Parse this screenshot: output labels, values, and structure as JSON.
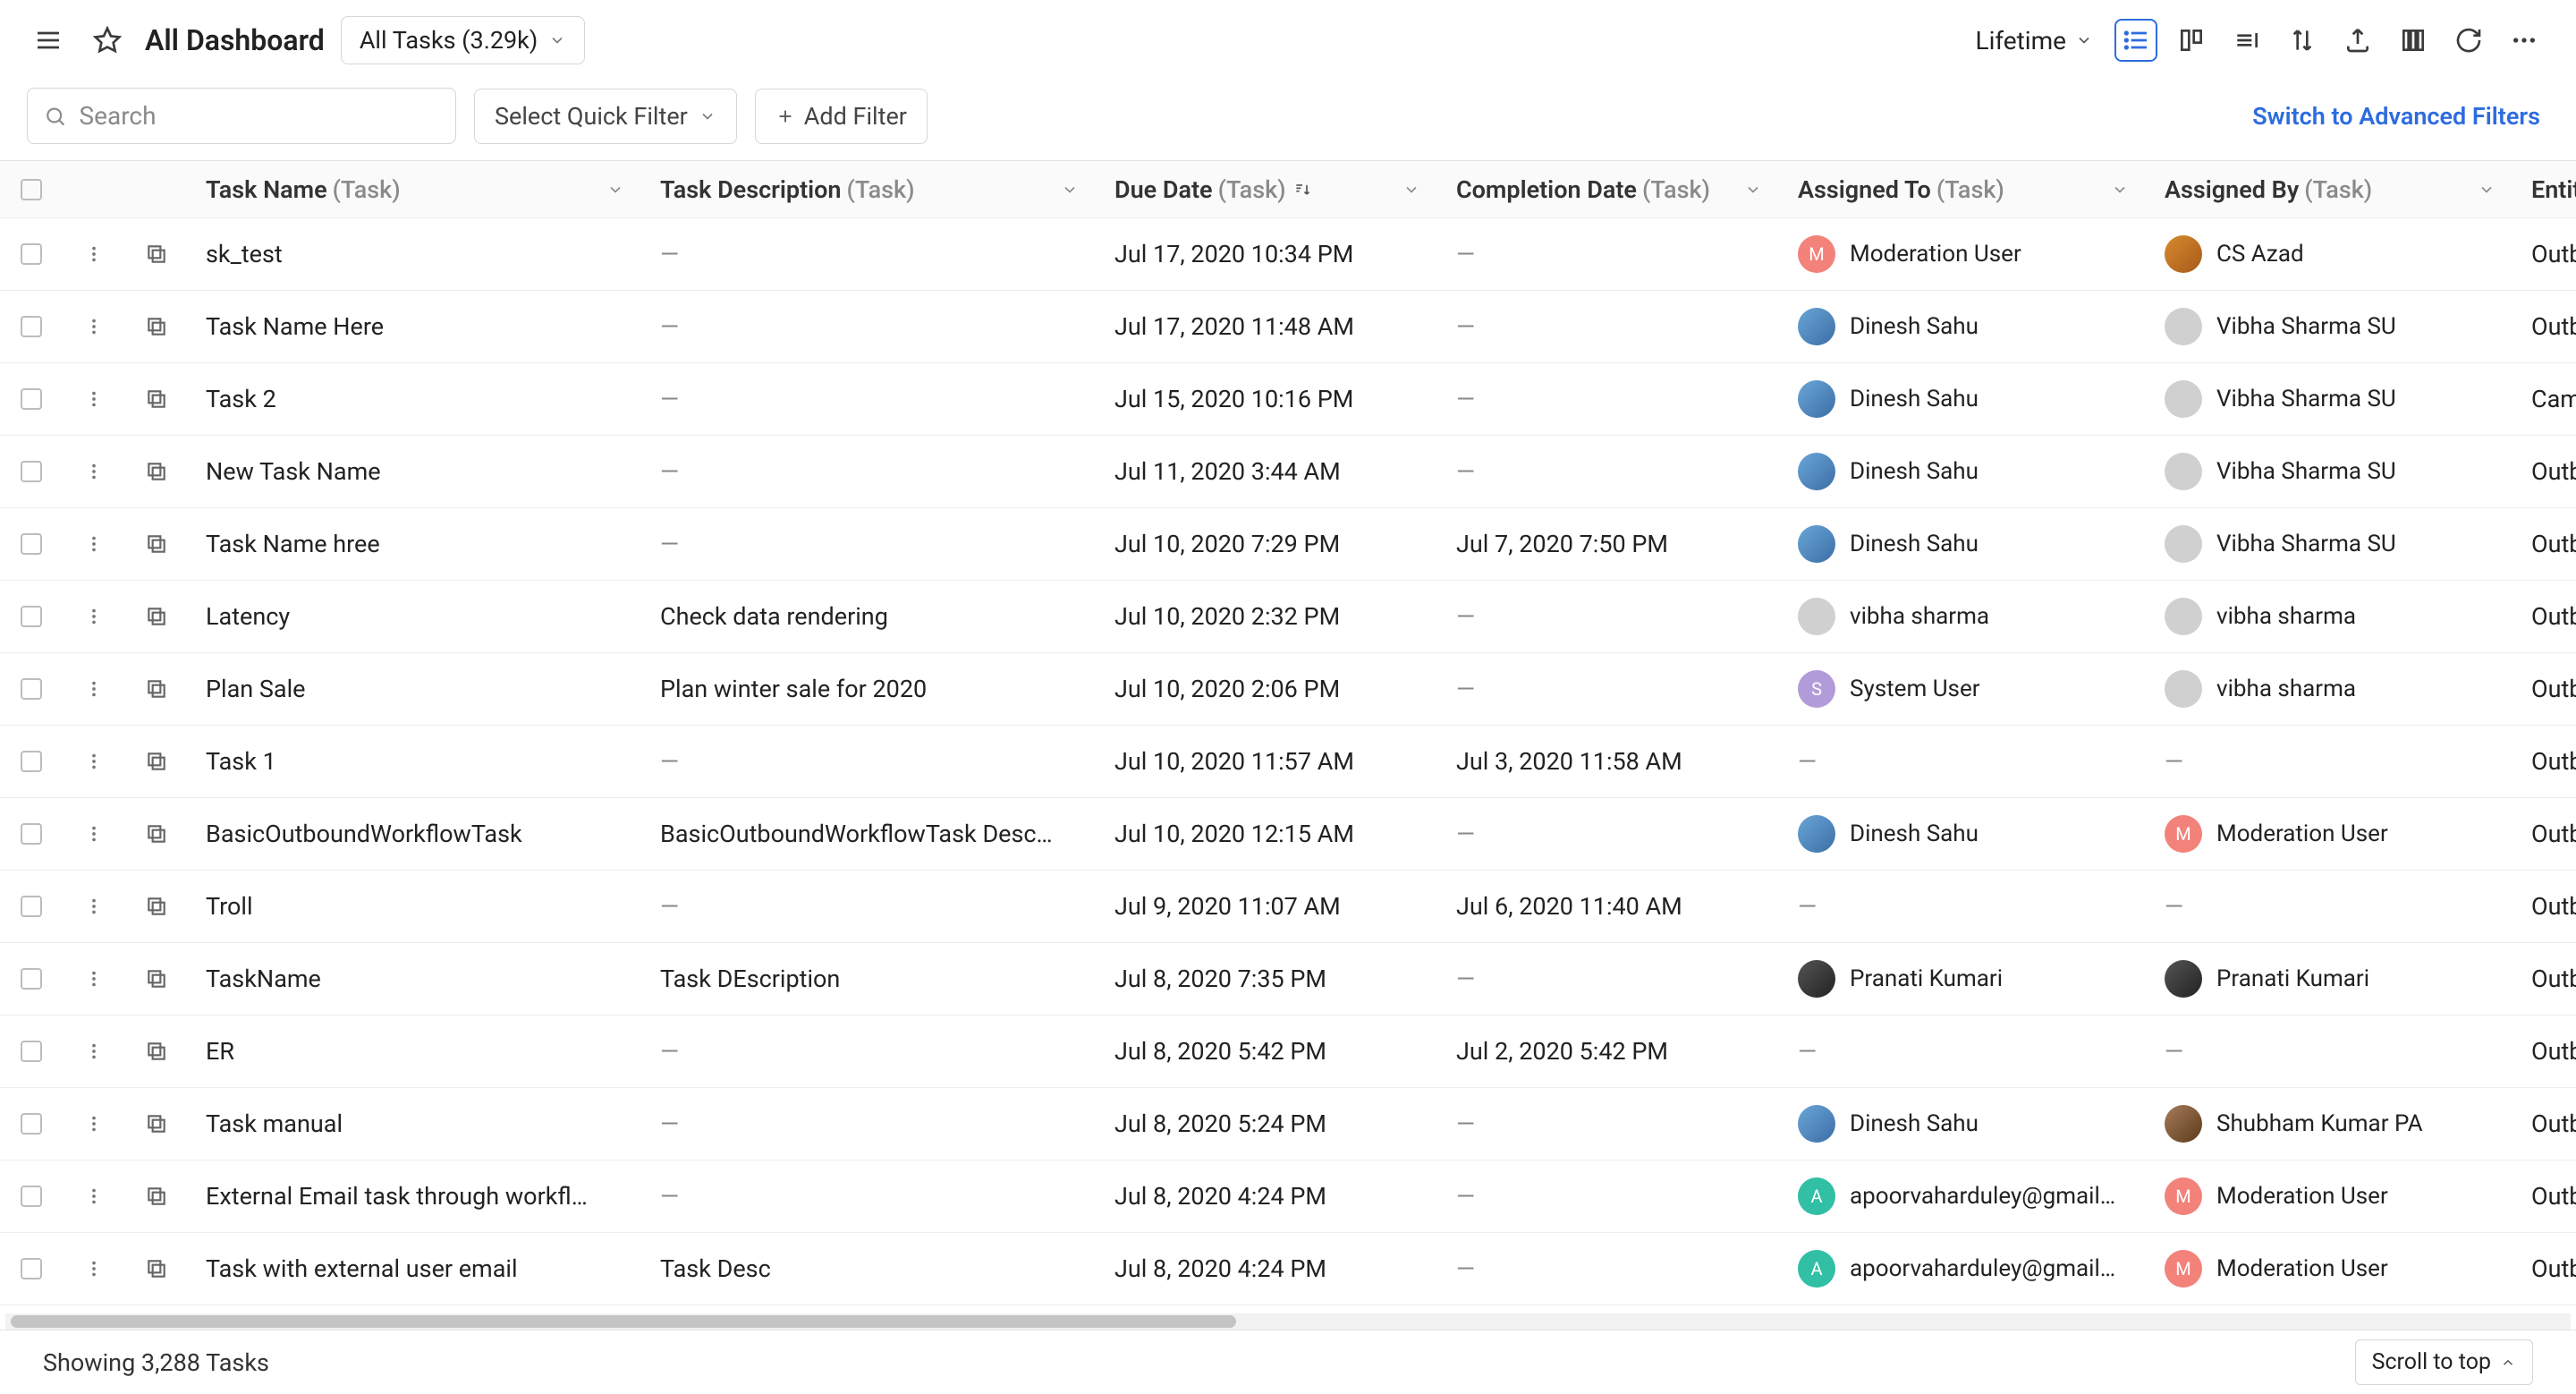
{
  "header": {
    "title": "All Dashboard",
    "filter_dropdown": "All Tasks  (3.29k)",
    "lifetime": "Lifetime"
  },
  "filters": {
    "search_placeholder": "Search",
    "quick_filter": "Select Quick Filter",
    "add_filter": "Add Filter",
    "advanced_link": "Switch to Advanced Filters"
  },
  "columns": {
    "name": "Task Name",
    "name_sub": "(Task)",
    "desc": "Task Description",
    "desc_sub": "(Task)",
    "due": "Due Date",
    "due_sub": "(Task)",
    "comp": "Completion Date",
    "comp_sub": "(Task)",
    "assto": "Assigned To",
    "assto_sub": "(Task)",
    "assby": "Assigned By",
    "assby_sub": "(Task)",
    "entity": "Entity T"
  },
  "rows": [
    {
      "name": "sk_test",
      "desc": "—",
      "due": "Jul 17, 2020 10:34 PM",
      "comp": "—",
      "assto": {
        "label": "Moderation User",
        "av": "M",
        "cls": "av-pink"
      },
      "assby": {
        "label": "CS Azad",
        "av": "",
        "cls": "av-img3"
      },
      "entity": "Outbou"
    },
    {
      "name": "Task Name Here",
      "desc": "—",
      "due": "Jul 17, 2020 11:48 AM",
      "comp": "—",
      "assto": {
        "label": "Dinesh Sahu",
        "av": "",
        "cls": "av-img"
      },
      "assby": {
        "label": "Vibha Sharma SU",
        "av": "",
        "cls": "av-gray"
      },
      "entity": "Outbou"
    },
    {
      "name": "Task 2",
      "desc": "—",
      "due": "Jul 15, 2020 10:16 PM",
      "comp": "—",
      "assto": {
        "label": "Dinesh Sahu",
        "av": "",
        "cls": "av-img"
      },
      "assby": {
        "label": "Vibha Sharma SU",
        "av": "",
        "cls": "av-gray"
      },
      "entity": "Campa"
    },
    {
      "name": "New Task Name",
      "desc": "—",
      "due": "Jul 11, 2020 3:44 AM",
      "comp": "—",
      "assto": {
        "label": "Dinesh Sahu",
        "av": "",
        "cls": "av-img"
      },
      "assby": {
        "label": "Vibha Sharma SU",
        "av": "",
        "cls": "av-gray"
      },
      "entity": "Outbou"
    },
    {
      "name": "Task Name hree",
      "desc": "—",
      "due": "Jul 10, 2020 7:29 PM",
      "comp": "Jul 7, 2020 7:50 PM",
      "assto": {
        "label": "Dinesh Sahu",
        "av": "",
        "cls": "av-img"
      },
      "assby": {
        "label": "Vibha Sharma SU",
        "av": "",
        "cls": "av-gray"
      },
      "entity": "Outbou"
    },
    {
      "name": "Latency",
      "desc": "Check data rendering",
      "due": "Jul 10, 2020 2:32 PM",
      "comp": "—",
      "assto": {
        "label": "vibha sharma",
        "av": "",
        "cls": "av-gray"
      },
      "assby": {
        "label": "vibha sharma",
        "av": "",
        "cls": "av-gray"
      },
      "entity": "Outbou"
    },
    {
      "name": "Plan Sale",
      "desc": "Plan winter sale for 2020",
      "due": "Jul 10, 2020 2:06 PM",
      "comp": "—",
      "assto": {
        "label": "System User",
        "av": "S",
        "cls": "av-purple"
      },
      "assby": {
        "label": "vibha sharma",
        "av": "",
        "cls": "av-gray"
      },
      "entity": "Outbou"
    },
    {
      "name": "Task 1",
      "desc": "—",
      "due": "Jul 10, 2020 11:57 AM",
      "comp": "Jul 3, 2020 11:58 AM",
      "assto": {
        "label": "—",
        "av": "",
        "cls": ""
      },
      "assby": {
        "label": "—",
        "av": "",
        "cls": ""
      },
      "entity": "Outbou"
    },
    {
      "name": "BasicOutboundWorkflowTask",
      "desc": "BasicOutboundWorkflowTask Desc…",
      "due": "Jul 10, 2020 12:15 AM",
      "comp": "—",
      "assto": {
        "label": "Dinesh Sahu",
        "av": "",
        "cls": "av-img"
      },
      "assby": {
        "label": "Moderation User",
        "av": "M",
        "cls": "av-pink"
      },
      "entity": "Outbou"
    },
    {
      "name": "Troll",
      "desc": "—",
      "due": "Jul 9, 2020 11:07 AM",
      "comp": "Jul 6, 2020 11:40 AM",
      "assto": {
        "label": "—",
        "av": "",
        "cls": ""
      },
      "assby": {
        "label": "—",
        "av": "",
        "cls": ""
      },
      "entity": "Outbou"
    },
    {
      "name": "TaskName",
      "desc": "Task DEscription",
      "due": "Jul 8, 2020 7:35 PM",
      "comp": "—",
      "assto": {
        "label": "Pranati Kumari",
        "av": "",
        "cls": "av-img2"
      },
      "assby": {
        "label": "Pranati Kumari",
        "av": "",
        "cls": "av-img2"
      },
      "entity": "Outbou"
    },
    {
      "name": "ER",
      "desc": "—",
      "due": "Jul 8, 2020 5:42 PM",
      "comp": "Jul 2, 2020 5:42 PM",
      "assto": {
        "label": "—",
        "av": "",
        "cls": ""
      },
      "assby": {
        "label": "—",
        "av": "",
        "cls": ""
      },
      "entity": "Outbou"
    },
    {
      "name": "Task manual",
      "desc": "—",
      "due": "Jul 8, 2020 5:24 PM",
      "comp": "—",
      "assto": {
        "label": "Dinesh Sahu",
        "av": "",
        "cls": "av-img"
      },
      "assby": {
        "label": "Shubham Kumar PA",
        "av": "",
        "cls": "av-img4"
      },
      "entity": "Outbou"
    },
    {
      "name": "External Email task through workfl…",
      "desc": "—",
      "due": "Jul 8, 2020 4:24 PM",
      "comp": "—",
      "assto": {
        "label": "apoorvaharduley@gmail…",
        "av": "A",
        "cls": "av-teal"
      },
      "assby": {
        "label": "Moderation User",
        "av": "M",
        "cls": "av-pink"
      },
      "entity": "Outbou"
    },
    {
      "name": "Task with external user email",
      "desc": "Task Desc",
      "due": "Jul 8, 2020 4:24 PM",
      "comp": "—",
      "assto": {
        "label": "apoorvaharduley@gmail…",
        "av": "A",
        "cls": "av-teal"
      },
      "assby": {
        "label": "Moderation User",
        "av": "M",
        "cls": "av-pink"
      },
      "entity": "Outbou"
    }
  ],
  "footer": {
    "showing": "Showing 3,288 Tasks",
    "scroll_top": "Scroll to top"
  }
}
